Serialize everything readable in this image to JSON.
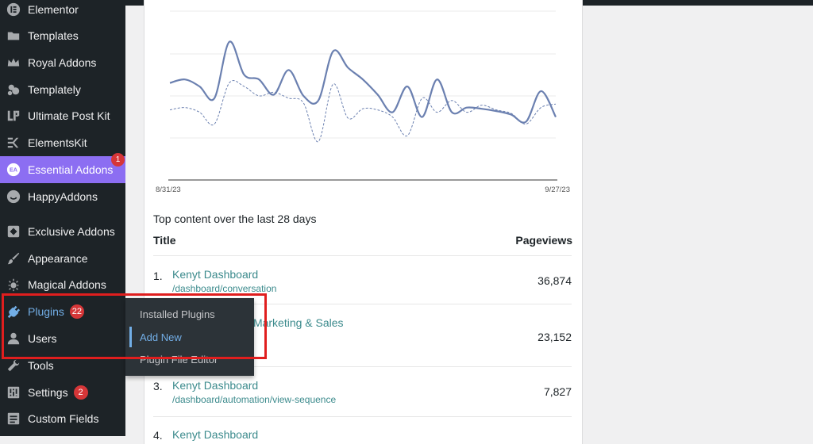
{
  "sidebar": {
    "items": [
      {
        "label": "Elementor",
        "icon": "elementor-icon"
      },
      {
        "label": "Templates",
        "icon": "folder-icon"
      },
      {
        "label": "Royal Addons",
        "icon": "crown-icon"
      },
      {
        "label": "Templately",
        "icon": "templately-icon"
      },
      {
        "label": "Ultimate Post Kit",
        "icon": "upk-icon"
      },
      {
        "label": "ElementsKit",
        "icon": "elementskit-icon"
      },
      {
        "label": "Essential Addons",
        "icon": "essential-addons-icon",
        "corner_badge": "1"
      },
      {
        "label": "HappyAddons",
        "icon": "happyaddons-icon"
      },
      {
        "label": "Exclusive Addons",
        "icon": "exclusive-addons-icon"
      },
      {
        "label": "Appearance",
        "icon": "paintbrush-icon"
      },
      {
        "label": "Magical Addons",
        "icon": "magical-addons-icon"
      },
      {
        "label": "Plugins",
        "icon": "plugin-icon",
        "badge": "22"
      },
      {
        "label": "Users",
        "icon": "user-icon"
      },
      {
        "label": "Tools",
        "icon": "wrench-icon"
      },
      {
        "label": "Settings",
        "icon": "settings-icon",
        "badge": "2"
      },
      {
        "label": "Custom Fields",
        "icon": "custom-fields-icon"
      }
    ]
  },
  "plugins_flyout": {
    "items": [
      "Installed Plugins",
      "Add New",
      "Plugin File Editor"
    ],
    "current": "Add New"
  },
  "chart_data": {
    "type": "line",
    "x_tick_labels": [
      "8/31/23",
      "9/27/23"
    ],
    "series": [
      {
        "values": [
          0.55,
          0.58,
          0.52,
          0.42,
          0.9,
          0.62,
          0.58,
          0.45,
          0.66,
          0.44,
          0.4,
          0.82,
          0.68,
          0.58,
          0.45,
          0.3,
          0.52,
          0.26,
          0.58,
          0.3,
          0.34,
          0.33,
          0.31,
          0.28,
          0.22,
          0.48,
          0.26
        ],
        "style": "solid",
        "color": "#6b80b0"
      },
      {
        "values": [
          0.32,
          0.34,
          0.3,
          0.2,
          0.55,
          0.52,
          0.44,
          0.47,
          0.42,
          0.38,
          0.05,
          0.54,
          0.25,
          0.33,
          0.32,
          0.26,
          0.1,
          0.42,
          0.3,
          0.4,
          0.3,
          0.36,
          0.32,
          0.29,
          0.2,
          0.34,
          0.37
        ],
        "style": "dashed",
        "color": "#6b80b0"
      }
    ],
    "ylim": [
      0,
      1
    ]
  },
  "widget": {
    "section_title": "Top content over the last 28 days",
    "col_title": "Title",
    "col_pageviews": "Pageviews",
    "rows": [
      {
        "num": "1.",
        "name": "Kenyt Dashboard",
        "path": "/dashboard/conversation",
        "pageviews": "36,874"
      },
      {
        "num": "",
        "name": "AI to Accelerate Marketing & Sales",
        "path": "",
        "pageviews": "23,152"
      },
      {
        "num": "3.",
        "name": "Kenyt Dashboard",
        "path": "/dashboard/automation/view-sequence",
        "pageviews": "7,827"
      },
      {
        "num": "4.",
        "name": "Kenyt Dashboard",
        "path": "",
        "pageviews": ""
      }
    ]
  }
}
